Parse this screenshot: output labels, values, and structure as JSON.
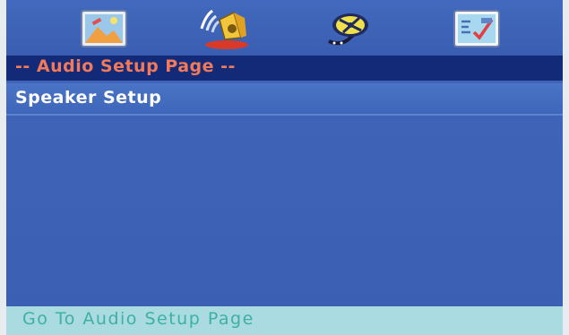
{
  "osd": {
    "tabs": [
      {
        "icon": "general-setup-icon",
        "active": false
      },
      {
        "icon": "audio-speaker-icon",
        "active": true
      },
      {
        "icon": "video-film-icon",
        "active": false
      },
      {
        "icon": "preference-icon",
        "active": false
      }
    ],
    "page_title": "-- Audio Setup Page --",
    "menu_items": [
      {
        "label": "Speaker Setup"
      }
    ],
    "status_text": "Go To Audio Setup Page"
  },
  "colors": {
    "background": "#3d61b5",
    "title_bar": "#132a78",
    "title_text": "#f27a5a",
    "menu_text": "#ffffff",
    "status_bar": "#a9dbe0",
    "status_text": "#3fb0a4"
  }
}
